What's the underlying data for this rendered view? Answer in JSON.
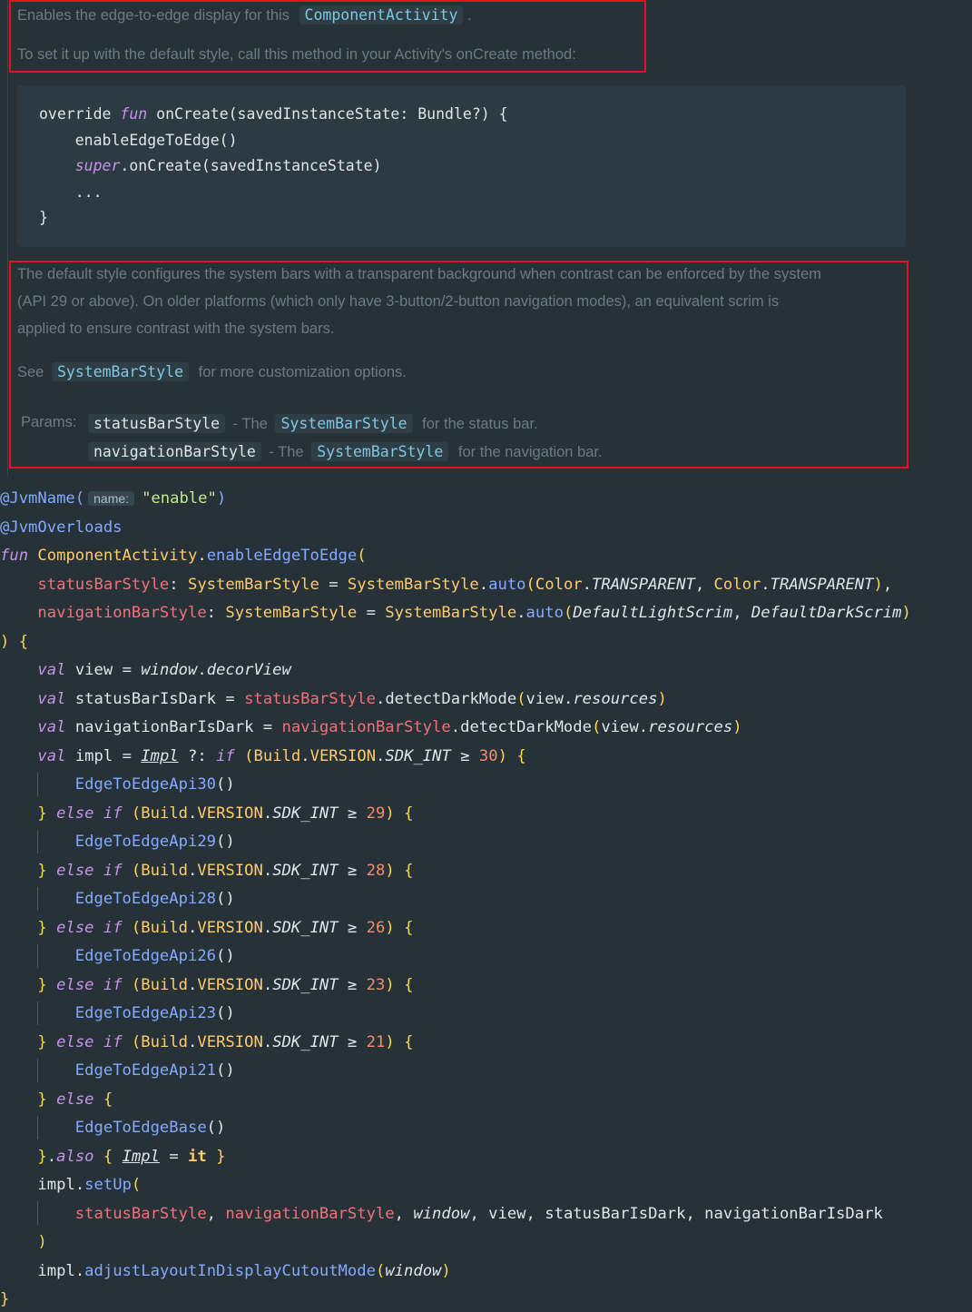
{
  "doc": {
    "intro_text": "Enables the edge-to-edge display for this",
    "intro_chip": "ComponentActivity",
    "intro_end": ".",
    "setup_text": "To set it up with the default style, call this method in your Activity's onCreate method:",
    "sample_code": [
      "override fun onCreate(savedInstanceState: Bundle?) {",
      "    enableEdgeToEdge()",
      "    super.onCreate(savedInstanceState)",
      "    ...",
      "}"
    ],
    "desc_lines": [
      "The default style configures the system bars with a transparent background when contrast can be enforced by the system",
      "(API 29 or above). On older platforms (which only have 3-button/2-button navigation modes), an equivalent scrim is",
      "applied to ensure contrast with the system bars."
    ],
    "see_label": "See",
    "see_chip": "SystemBarStyle",
    "see_tail": "for more customization options.",
    "params_label": "Params:",
    "params": [
      {
        "name": "statusBarStyle",
        "dash": "- The",
        "type": "SystemBarStyle",
        "tail": "for the status bar."
      },
      {
        "name": "navigationBarStyle",
        "dash": "- The",
        "type": "SystemBarStyle",
        "tail": "for the navigation bar."
      }
    ]
  },
  "code": {
    "annotation_jvmname": "@JvmName(",
    "hint_name": "name:",
    "jvmname_value": "\"enable\"",
    "annotation_overloads": "@JvmOverloads",
    "receiver": "ComponentActivity",
    "function_name": "enableEdgeToEdge",
    "param_status": "statusBarStyle",
    "param_nav": "navigationBarStyle",
    "type_style": "SystemBarStyle",
    "auto_fn": "auto",
    "color_cls": "Color",
    "transparent": "TRANSPARENT",
    "light_scrim": "DefaultLightScrim",
    "dark_scrim": "DefaultDarkScrim",
    "var_view": "view",
    "var_status_dark": "statusBarIsDark",
    "var_nav_dark": "navigationBarIsDark",
    "var_impl": "impl",
    "impl_obj": "Impl",
    "detect_fn": "detectDarkMode",
    "resources": "resources",
    "window": "window",
    "decor_view": "decorView",
    "build_cls": "Build",
    "version": "VERSION",
    "sdk_int": "SDK_INT",
    "api_levels": [
      "30",
      "29",
      "28",
      "26",
      "23",
      "21"
    ],
    "api_classes": [
      "EdgeToEdgeApi30",
      "EdgeToEdgeApi29",
      "EdgeToEdgeApi28",
      "EdgeToEdgeApi26",
      "EdgeToEdgeApi23",
      "EdgeToEdgeApi21"
    ],
    "base_class": "EdgeToEdgeBase",
    "also_fn": "also",
    "it_kw": "it",
    "setup_fn": "setUp",
    "adjust_fn": "adjustLayoutInDisplayCutoutMode"
  }
}
